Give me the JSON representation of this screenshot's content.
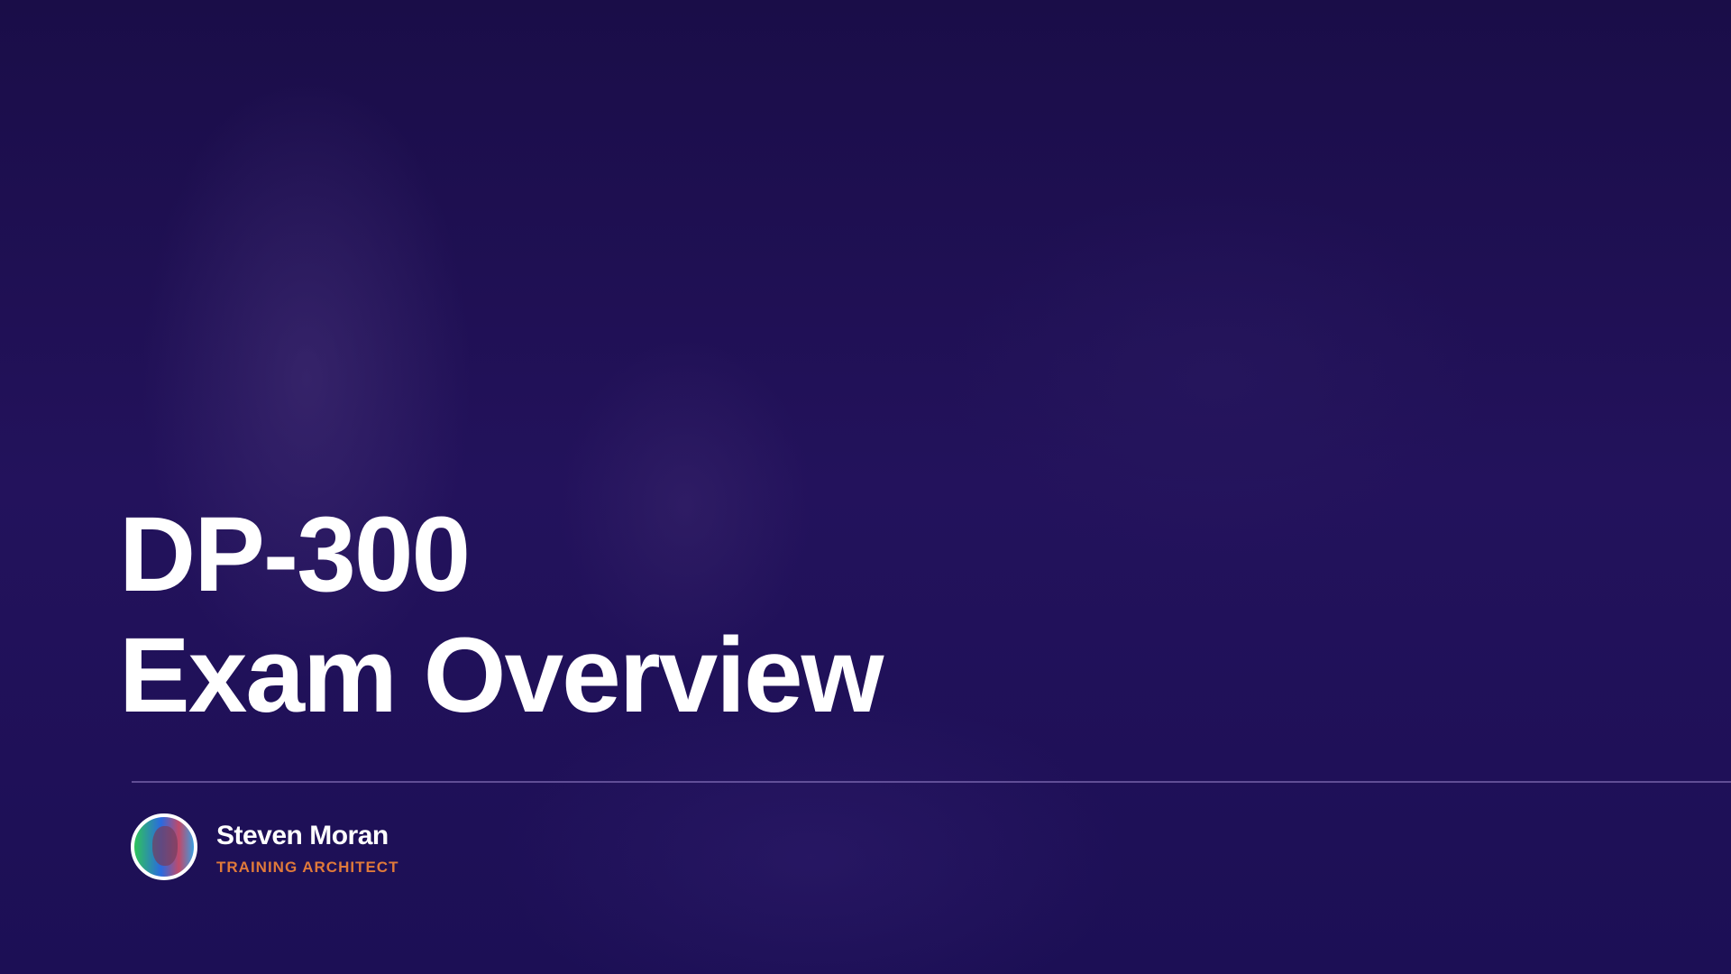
{
  "slide": {
    "title_line1": "DP-300",
    "title_line2": "Exam Overview"
  },
  "presenter": {
    "name": "Steven Moran",
    "role": "TRAINING ARCHITECT"
  },
  "colors": {
    "background": "#1d0f50",
    "accent": "#e07a3a",
    "text": "#ffffff"
  }
}
